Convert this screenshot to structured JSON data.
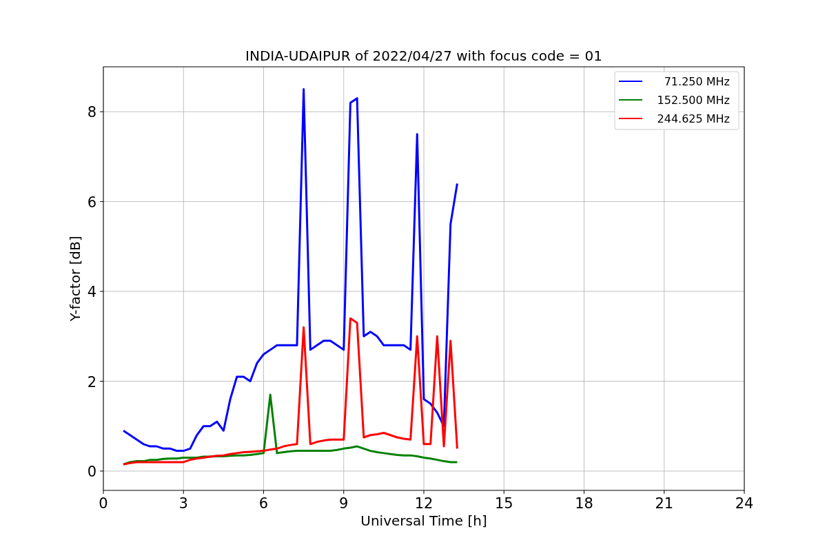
{
  "chart_data": {
    "type": "line",
    "title": "INDIA-UDAIPUR of 2022/04/27 with focus code = 01",
    "xlabel": "Universal Time [h]",
    "ylabel": "Y-factor [dB]",
    "x": [
      0.75,
      1.0,
      1.25,
      1.5,
      1.75,
      2.0,
      2.25,
      2.5,
      2.75,
      3.0,
      3.25,
      3.5,
      3.75,
      4.0,
      4.25,
      4.5,
      4.75,
      5.0,
      5.25,
      5.5,
      5.75,
      6.0,
      6.25,
      6.5,
      6.75,
      7.0,
      7.25,
      7.5,
      7.75,
      8.0,
      8.25,
      8.5,
      8.75,
      9.0,
      9.25,
      9.5,
      9.75,
      10.0,
      10.25,
      10.5,
      10.75,
      11.0,
      11.25,
      11.5,
      11.75,
      12.0,
      12.25,
      12.5,
      12.75,
      13.0,
      13.25
    ],
    "series": [
      {
        "name": "71.250 MHz",
        "color": "#0000ff",
        "values": [
          0.9,
          0.8,
          0.7,
          0.6,
          0.55,
          0.55,
          0.5,
          0.5,
          0.45,
          0.45,
          0.5,
          0.8,
          1.0,
          1.0,
          1.1,
          0.9,
          1.6,
          2.1,
          2.1,
          2.0,
          2.4,
          2.6,
          2.7,
          2.8,
          2.8,
          2.8,
          2.8,
          8.5,
          2.7,
          2.8,
          2.9,
          2.9,
          2.8,
          2.7,
          8.2,
          8.3,
          3.0,
          3.1,
          3.0,
          2.8,
          2.8,
          2.8,
          2.8,
          2.7,
          7.5,
          1.6,
          1.5,
          1.3,
          1.0,
          5.5,
          6.4
        ]
      },
      {
        "name": "152.500 MHz",
        "color": "#008000",
        "values": [
          0.15,
          0.2,
          0.22,
          0.22,
          0.25,
          0.25,
          0.27,
          0.28,
          0.28,
          0.3,
          0.3,
          0.3,
          0.32,
          0.32,
          0.33,
          0.33,
          0.34,
          0.35,
          0.35,
          0.36,
          0.38,
          0.4,
          1.7,
          0.4,
          0.42,
          0.44,
          0.45,
          0.45,
          0.45,
          0.45,
          0.45,
          0.45,
          0.47,
          0.5,
          0.52,
          0.55,
          0.5,
          0.45,
          0.42,
          0.4,
          0.38,
          0.36,
          0.35,
          0.35,
          0.33,
          0.3,
          0.28,
          0.25,
          0.22,
          0.2,
          0.2
        ]
      },
      {
        "name": "244.625 MHz",
        "color": "#ff0000",
        "values": [
          0.15,
          0.18,
          0.2,
          0.2,
          0.2,
          0.2,
          0.2,
          0.2,
          0.2,
          0.2,
          0.25,
          0.28,
          0.3,
          0.32,
          0.34,
          0.35,
          0.38,
          0.4,
          0.42,
          0.43,
          0.44,
          0.45,
          0.48,
          0.5,
          0.55,
          0.58,
          0.6,
          3.2,
          0.6,
          0.65,
          0.68,
          0.7,
          0.7,
          0.7,
          3.4,
          3.3,
          0.75,
          0.8,
          0.82,
          0.85,
          0.8,
          0.75,
          0.72,
          0.7,
          3.0,
          0.6,
          0.6,
          3.0,
          0.55,
          2.9,
          0.5
        ]
      }
    ],
    "grid": true,
    "legend": "upper right",
    "xlim": [
      0,
      24
    ],
    "ylim": [
      -0.43,
      9.0
    ],
    "xticks": [
      0,
      3,
      6,
      9,
      12,
      15,
      18,
      21,
      24
    ],
    "yticks": [
      0,
      2,
      4,
      6,
      8
    ]
  }
}
